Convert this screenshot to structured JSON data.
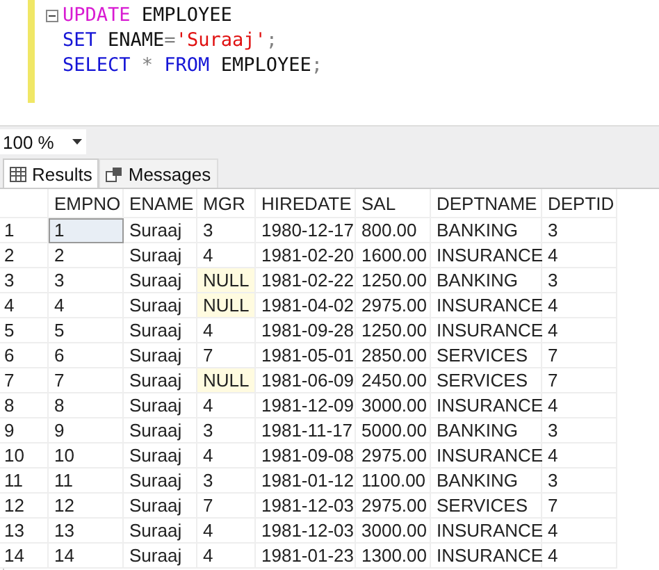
{
  "editor": {
    "lines": [
      {
        "foldable": true,
        "tokens": [
          {
            "kind": "dml",
            "text": "UPDATE"
          },
          {
            "kind": "ident",
            "text": " EMPLOYEE"
          }
        ]
      },
      {
        "foldable": false,
        "tokens": [
          {
            "kind": "keyword",
            "text": "SET"
          },
          {
            "kind": "ident",
            "text": " ENAME"
          },
          {
            "kind": "operator",
            "text": "="
          },
          {
            "kind": "string",
            "text": "'Suraaj'"
          },
          {
            "kind": "operator",
            "text": ";"
          }
        ]
      },
      {
        "foldable": false,
        "tokens": [
          {
            "kind": "keyword",
            "text": "SELECT"
          },
          {
            "kind": "operator",
            "text": " * "
          },
          {
            "kind": "keyword",
            "text": "FROM"
          },
          {
            "kind": "ident",
            "text": " EMPLOYEE"
          },
          {
            "kind": "operator",
            "text": ";"
          }
        ]
      }
    ]
  },
  "zoom": {
    "value": "100 %"
  },
  "tabs": [
    {
      "label": "Results",
      "selected": true
    },
    {
      "label": "Messages",
      "selected": false
    }
  ],
  "table": {
    "columns": [
      "EMPNO",
      "ENAME",
      "MGR",
      "HIREDATE",
      "SAL",
      "DEPTNAME",
      "DEPTID"
    ],
    "rows": [
      {
        "number": "1",
        "selected": true,
        "mgr_null": false,
        "cells": [
          "1",
          "Suraaj",
          "3",
          "1980-12-17",
          "800.00",
          "BANKING",
          "3"
        ]
      },
      {
        "number": "2",
        "selected": false,
        "mgr_null": false,
        "cells": [
          "2",
          "Suraaj",
          "4",
          "1981-02-20",
          "1600.00",
          "INSURANCE",
          "4"
        ]
      },
      {
        "number": "3",
        "selected": false,
        "mgr_null": true,
        "cells": [
          "3",
          "Suraaj",
          "NULL",
          "1981-02-22",
          "1250.00",
          "BANKING",
          "3"
        ]
      },
      {
        "number": "4",
        "selected": false,
        "mgr_null": true,
        "cells": [
          "4",
          "Suraaj",
          "NULL",
          "1981-04-02",
          "2975.00",
          "INSURANCE",
          "4"
        ]
      },
      {
        "number": "5",
        "selected": false,
        "mgr_null": false,
        "cells": [
          "5",
          "Suraaj",
          "4",
          "1981-09-28",
          "1250.00",
          "INSURANCE",
          "4"
        ]
      },
      {
        "number": "6",
        "selected": false,
        "mgr_null": false,
        "cells": [
          "6",
          "Suraaj",
          "7",
          "1981-05-01",
          "2850.00",
          "SERVICES",
          "7"
        ]
      },
      {
        "number": "7",
        "selected": false,
        "mgr_null": true,
        "cells": [
          "7",
          "Suraaj",
          "NULL",
          "1981-06-09",
          "2450.00",
          "SERVICES",
          "7"
        ]
      },
      {
        "number": "8",
        "selected": false,
        "mgr_null": false,
        "cells": [
          "8",
          "Suraaj",
          "4",
          "1981-12-09",
          "3000.00",
          "INSURANCE",
          "4"
        ]
      },
      {
        "number": "9",
        "selected": false,
        "mgr_null": false,
        "cells": [
          "9",
          "Suraaj",
          "3",
          "1981-11-17",
          "5000.00",
          "BANKING",
          "3"
        ]
      },
      {
        "number": "10",
        "selected": false,
        "mgr_null": false,
        "cells": [
          "10",
          "Suraaj",
          "4",
          "1981-09-08",
          "2975.00",
          "INSURANCE",
          "4"
        ]
      },
      {
        "number": "11",
        "selected": false,
        "mgr_null": false,
        "cells": [
          "11",
          "Suraaj",
          "3",
          "1981-01-12",
          "1100.00",
          "BANKING",
          "3"
        ]
      },
      {
        "number": "12",
        "selected": false,
        "mgr_null": false,
        "cells": [
          "12",
          "Suraaj",
          "7",
          "1981-12-03",
          "2975.00",
          "SERVICES",
          "7"
        ]
      },
      {
        "number": "13",
        "selected": false,
        "mgr_null": false,
        "cells": [
          "13",
          "Suraaj",
          "4",
          "1981-12-03",
          "3000.00",
          "INSURANCE",
          "4"
        ]
      },
      {
        "number": "14",
        "selected": false,
        "mgr_null": false,
        "cells": [
          "14",
          "Suraaj",
          "4",
          "1981-01-23",
          "1300.00",
          "INSURANCE",
          "4"
        ]
      }
    ]
  }
}
